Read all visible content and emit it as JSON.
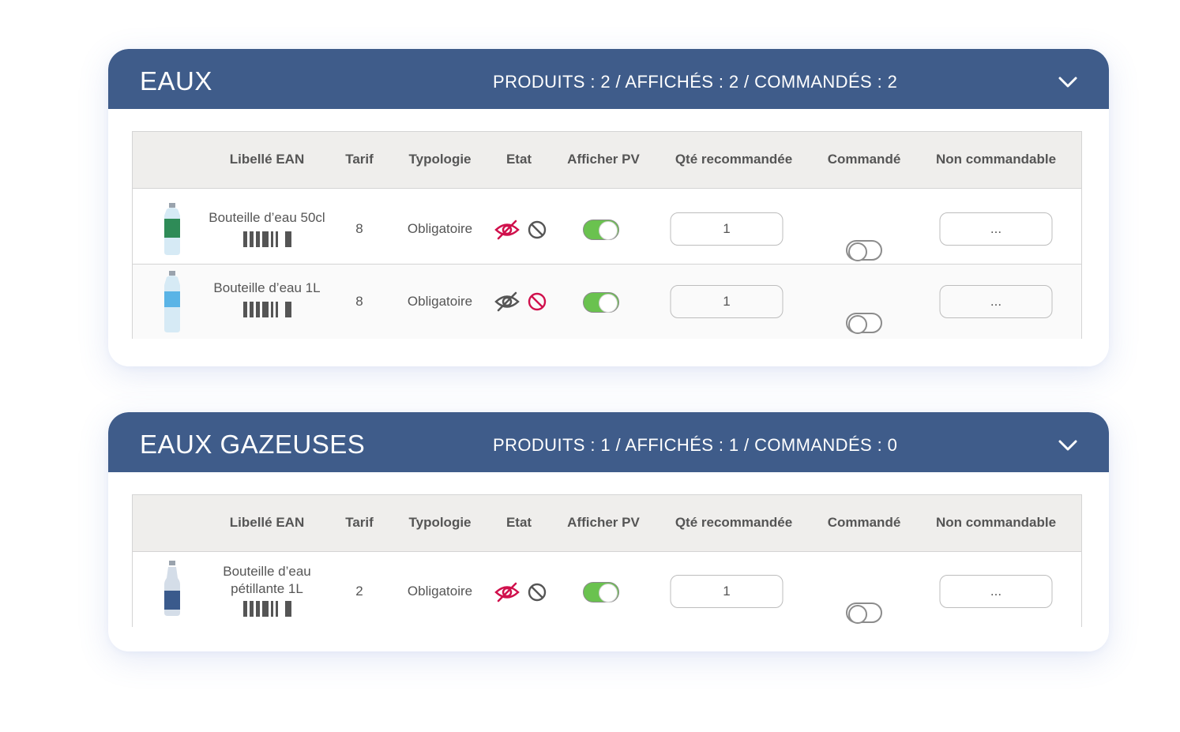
{
  "colors": {
    "header_bg": "#3f5c8a",
    "toggle_on": "#6ac24f",
    "alert_red": "#d0104c",
    "neutral_icon": "#555555"
  },
  "columns": [
    "Libellé EAN",
    "Tarif",
    "Typologie",
    "Etat",
    "Afficher PV",
    "Qté recommandée",
    "Commandé",
    "Non commandable"
  ],
  "sections": [
    {
      "title": "EAUX",
      "stats": "PRODUITS : 2 / AFFICHÉS : 2 / COMMANDÉS : 2",
      "rows": [
        {
          "label": "Bouteille d’eau 50cl",
          "tarif": "8",
          "typologie": "Obligatoire",
          "icon": "bottle-icon",
          "label_color": "#2e8b57",
          "eye_hidden_active": true,
          "block_active": false,
          "afficher_pv": true,
          "qte": "1",
          "commande": false,
          "non_commandable": "..."
        },
        {
          "label": "Bouteille d’eau 1L",
          "tarif": "8",
          "typologie": "Obligatoire",
          "icon": "bottle-icon",
          "label_color": "#5ab4e6",
          "eye_hidden_active": false,
          "block_active": true,
          "afficher_pv": true,
          "qte": "1",
          "commande": false,
          "non_commandable": "..."
        }
      ]
    },
    {
      "title": "EAUX GAZEUSES",
      "stats": "PRODUITS : 1 / AFFICHÉS : 1 / COMMANDÉS : 0",
      "rows": [
        {
          "label": "Bouteille d’eau pétillante 1L",
          "tarif": "2",
          "typologie": "Obligatoire",
          "icon": "bottle-icon",
          "label_color": "#3a5a8c",
          "eye_hidden_active": true,
          "block_active": false,
          "afficher_pv": true,
          "qte": "1",
          "commande": false,
          "non_commandable": "..."
        }
      ]
    }
  ]
}
